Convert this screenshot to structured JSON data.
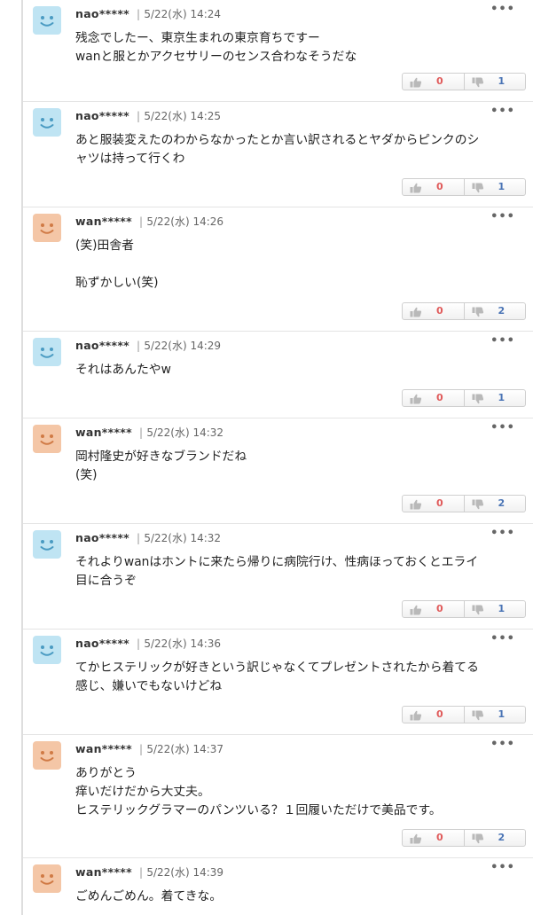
{
  "colors": {
    "blue_avatar": "#bfe4f3",
    "orange_avatar": "#f4c6a6",
    "like": "#e05a5a",
    "dislike": "#4a74b5"
  },
  "icons": {
    "avatar": "smiley-face-icon",
    "like": "thumbs-up-icon",
    "dislike": "thumbs-down-icon",
    "menu": "more-dots-icon"
  },
  "menu_label": "•••",
  "comments": [
    {
      "author": "nao*****",
      "time": "5/22(水) 14:24",
      "avatar_color": "blue",
      "text": "残念でしたー、東京生まれの東京育ちですー\nwanと服とかアクセサリーのセンス合わなそうだな",
      "likes": "0",
      "dislikes": "1"
    },
    {
      "author": "nao*****",
      "time": "5/22(水) 14:25",
      "avatar_color": "blue",
      "text": "あと服装変えたのわからなかったとか言い訳されるとヤダからピンクのシ\nャツは持って行くわ",
      "likes": "0",
      "dislikes": "1"
    },
    {
      "author": "wan*****",
      "time": "5/22(水) 14:26",
      "avatar_color": "orange",
      "text": "(笑)田舎者\n\n恥ずかしい(笑)",
      "likes": "0",
      "dislikes": "2"
    },
    {
      "author": "nao*****",
      "time": "5/22(水) 14:29",
      "avatar_color": "blue",
      "text": "それはあんたやw",
      "likes": "0",
      "dislikes": "1"
    },
    {
      "author": "wan*****",
      "time": "5/22(水) 14:32",
      "avatar_color": "orange",
      "text": "岡村隆史が好きなブランドだね\n(笑)",
      "likes": "0",
      "dislikes": "2"
    },
    {
      "author": "nao*****",
      "time": "5/22(水) 14:32",
      "avatar_color": "blue",
      "text": "それよりwanはホントに来たら帰りに病院行け、性病ほっておくとエライ\n目に合うぞ",
      "likes": "0",
      "dislikes": "1"
    },
    {
      "author": "nao*****",
      "time": "5/22(水) 14:36",
      "avatar_color": "blue",
      "text": "てかヒステリックが好きという訳じゃなくてプレゼントされたから着てる\n感じ、嫌いでもないけどね",
      "likes": "0",
      "dislikes": "1"
    },
    {
      "author": "wan*****",
      "time": "5/22(水) 14:37",
      "avatar_color": "orange",
      "text": "ありがとう\n痒いだけだから大丈夫。\nヒステリックグラマーのパンツいる？１回履いただけで美品です。",
      "likes": "0",
      "dislikes": "2"
    },
    {
      "author": "wan*****",
      "time": "5/22(水) 14:39",
      "avatar_color": "orange",
      "text": "ごめんごめん。着てきな。",
      "likes": "",
      "dislikes": ""
    }
  ]
}
